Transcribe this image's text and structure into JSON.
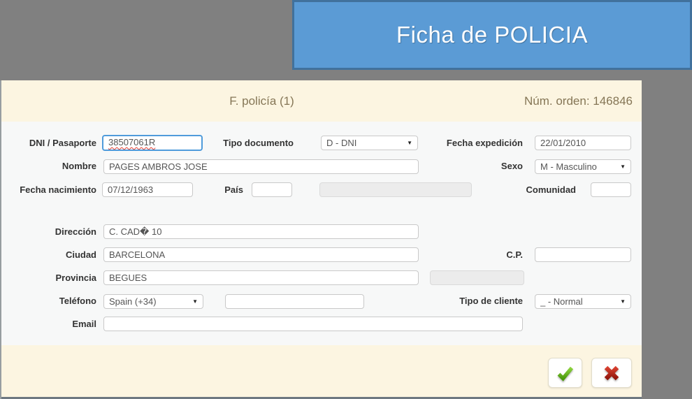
{
  "banner": {
    "title": "Ficha de POLICIA"
  },
  "header": {
    "title": "F. policía (1)",
    "order": "Núm. orden: 146846"
  },
  "fields": {
    "dni": {
      "label": "DNI / Pasaporte",
      "value": "38507061R"
    },
    "tipo_documento": {
      "label": "Tipo documento",
      "value": "D - DNI"
    },
    "fecha_expedicion": {
      "label": "Fecha expedición",
      "value": "22/01/2010"
    },
    "nombre": {
      "label": "Nombre",
      "value": "PAGES AMBROS JOSE"
    },
    "sexo": {
      "label": "Sexo",
      "value": "M - Masculino"
    },
    "fecha_nacimiento": {
      "label": "Fecha nacimiento",
      "value": "07/12/1963"
    },
    "pais": {
      "label": "País",
      "value": "",
      "display": ""
    },
    "comunidad": {
      "label": "Comunidad",
      "value": ""
    },
    "direccion": {
      "label": "Dirección",
      "value": "C. CAD� 10"
    },
    "ciudad": {
      "label": "Ciudad",
      "value": "BARCELONA"
    },
    "cp": {
      "label": "C.P.",
      "value": ""
    },
    "provincia": {
      "label": "Provincia",
      "value": "BEGUES",
      "display": ""
    },
    "telefono": {
      "label": "Teléfono",
      "prefix": "Spain (+34)",
      "value": ""
    },
    "tipo_cliente": {
      "label": "Tipo de cliente",
      "value": "_ - Normal"
    },
    "email": {
      "label": "Email",
      "value": ""
    }
  },
  "icons": {
    "dropdown_glyph": "▼",
    "accept": "check-icon",
    "cancel": "x-icon"
  },
  "colors": {
    "page_gray": "#808080",
    "banner_blue": "#5b9bd5",
    "banner_border": "#41719c",
    "cream": "#fcf5e1",
    "focus_blue": "#4f9bdb",
    "accent_green": "#5aa717",
    "accent_red": "#b2231a"
  }
}
